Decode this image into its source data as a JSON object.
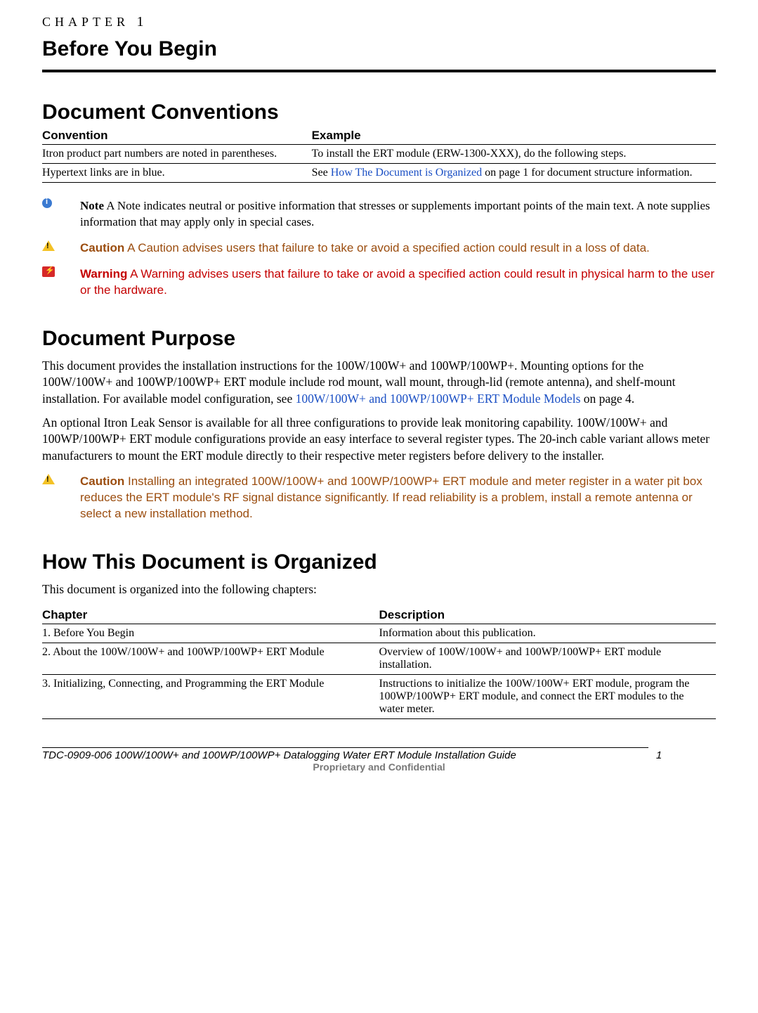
{
  "chapter": {
    "label_word": "CHAPTER",
    "label_num": "1",
    "title": "Before You Begin"
  },
  "sections": {
    "conventions_title": "Document Conventions",
    "purpose_title": "Document Purpose",
    "organized_title": "How This Document is Organized"
  },
  "conventions_table": {
    "headers": {
      "c1": "Convention",
      "c2": "Example"
    },
    "rows": [
      {
        "c1": "Itron product part numbers are noted in parentheses.",
        "c2_pre": "To install the ERT module (ERW-1300-XXX), do the following steps.",
        "c2_link": "",
        "c2_post": ""
      },
      {
        "c1": "Hypertext links are in blue.",
        "c2_pre": "See ",
        "c2_link": "How The Document is Organized",
        "c2_post": " on page 1 for document structure information."
      }
    ]
  },
  "admonitions": {
    "note": {
      "label": "Note",
      "text": "  A Note indicates neutral or positive information that stresses or supplements important points of the main text. A note supplies information that may apply only in special cases."
    },
    "caution1": {
      "label": "Caution",
      "text": "  A Caution advises users that failure to take or avoid a specified action could result in a loss of data."
    },
    "warning": {
      "label": "Warning",
      "text": "  A Warning advises users that failure to take or avoid a specified action could result in physical harm to the user or the hardware."
    },
    "caution2": {
      "label": "Caution",
      "text": "  Installing an integrated 100W/100W+ and 100WP/100WP+ ERT module and meter register in a water pit box reduces the ERT module's RF signal distance significantly. If read reliability is a problem, install a remote antenna or select a new installation method."
    }
  },
  "purpose": {
    "p1_pre": "This document provides the installation instructions for the 100W/100W+ and 100WP/100WP+. Mounting options for the 100W/100W+ and 100WP/100WP+ ERT module include rod mount, wall mount, through-lid (remote antenna), and shelf-mount installation. For available model configuration, see ",
    "p1_link": "100W/100W+ and 100WP/100WP+ ERT Module Models",
    "p1_post": " on page 4.",
    "p2": "An optional Itron Leak Sensor is available for all three configurations to provide leak monitoring capability. 100W/100W+ and 100WP/100WP+ ERT module configurations provide an easy interface to several register types. The 20-inch cable variant allows meter manufacturers to mount the ERT module directly to their respective meter registers before delivery to the installer."
  },
  "organized": {
    "intro": "This document is organized into the following chapters:",
    "headers": {
      "c1": "Chapter",
      "c2": "Description"
    },
    "rows": [
      {
        "c1": "1. Before You Begin",
        "c2": "Information about this publication."
      },
      {
        "c1": "2. About the 100W/100W+ and 100WP/100WP+ ERT Module",
        "c2": "Overview of 100W/100W+ and 100WP/100WP+ ERT module installation."
      },
      {
        "c1": "3. Initializing, Connecting, and Programming the ERT Module",
        "c2": "Instructions to initialize the 100W/100W+ ERT module, program the 100WP/100WP+ ERT module, and connect the ERT modules to the water meter."
      }
    ]
  },
  "footer": {
    "left": "TDC-0909-006 100W/100W+ and 100WP/100WP+ Datalogging Water ERT Module Installation Guide",
    "right": "1",
    "sub": "Proprietary and Confidential"
  }
}
